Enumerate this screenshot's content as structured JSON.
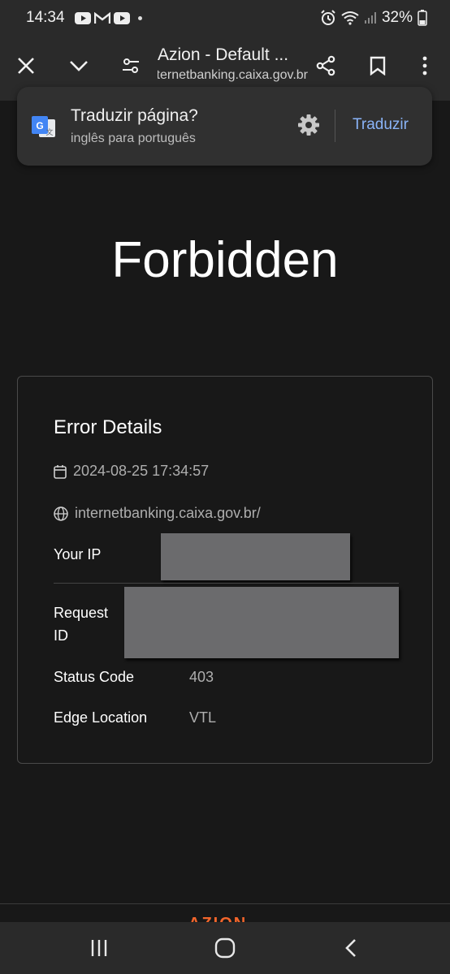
{
  "status_bar": {
    "time": "14:34",
    "battery": "32%"
  },
  "browser": {
    "page_title": "Azion - Default ...",
    "url": "internetbanking.caixa.gov.br"
  },
  "translate": {
    "title": "Traduzir página?",
    "subtitle": "inglês para português",
    "action": "Traduzir"
  },
  "page": {
    "heading": "Forbidden",
    "card_title": "Error Details",
    "timestamp": "2024-08-25 17:34:57",
    "host": "internetbanking.caixa.gov.br/",
    "fields": [
      {
        "label": "Your IP",
        "value": ""
      },
      {
        "label": "Request ID",
        "value": ""
      },
      {
        "label": "Status Code",
        "value": "403"
      },
      {
        "label": "Edge Location",
        "value": "VTL"
      }
    ],
    "footer_logo": "AZION"
  },
  "colors": {
    "background": "#181818",
    "accent_link": "#8ab4f8",
    "brand_orange": "#f3652b"
  }
}
